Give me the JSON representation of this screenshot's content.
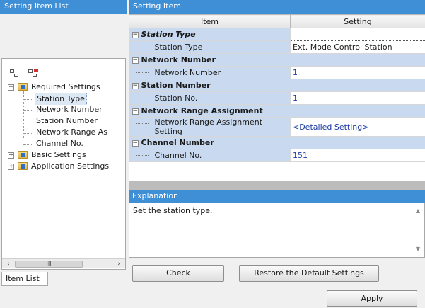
{
  "left_panel": {
    "title": "Setting Item List",
    "tree": {
      "required": "Required Settings",
      "children": [
        "Station Type",
        "Network Number",
        "Station Number",
        "Network Range As",
        "Channel No."
      ],
      "basic": "Basic Settings",
      "application": "Application Settings"
    },
    "scrollbar": {
      "left": "‹",
      "thumb": "III",
      "right": "›"
    },
    "tab": "Item List"
  },
  "right_panel": {
    "title": "Setting Item",
    "columns": {
      "item": "Item",
      "setting": "Setting"
    },
    "groups": [
      {
        "name": "Station Type",
        "item": "Station Type",
        "value": "Ext. Mode Control Station"
      },
      {
        "name": "Network Number",
        "item": "Network Number",
        "value": "1"
      },
      {
        "name": "Station Number",
        "item": "Station No.",
        "value": "1"
      },
      {
        "name": "Network Range Assignment",
        "item": "Network Range Assignment Setting",
        "value": "<Detailed Setting>"
      },
      {
        "name": "Channel Number",
        "item": "Channel No.",
        "value": "151"
      }
    ],
    "explanation": {
      "title": "Explanation",
      "text": "Set the station type."
    },
    "buttons": {
      "check": "Check",
      "restore": "Restore the Default Settings"
    }
  },
  "footer": {
    "apply": "Apply"
  },
  "colors": {
    "header_blue": "#3f8fd7",
    "group_blue": "#c9daf0",
    "link_blue": "#1b3aa3"
  },
  "icons": [
    "collapse-all-icon",
    "expand-all-icon",
    "folder-icon",
    "tree-expand-icon",
    "tree-collapse-icon"
  ]
}
